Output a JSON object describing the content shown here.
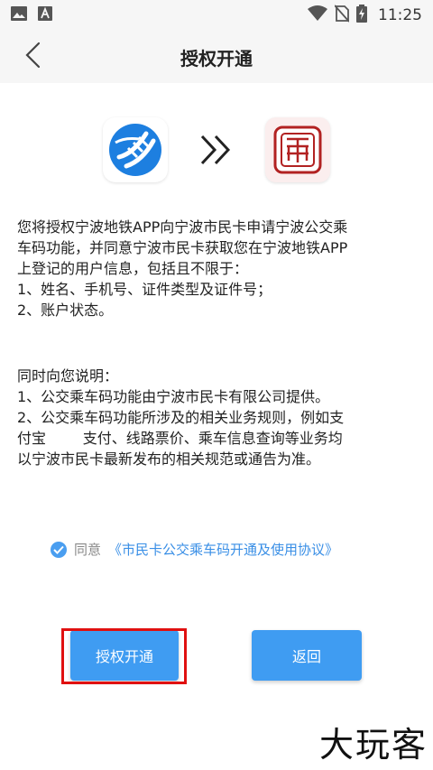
{
  "status_bar": {
    "time": "11:25",
    "icons": [
      "image-icon",
      "a-icon",
      "wifi-icon",
      "no-sim-icon",
      "battery-charging-icon"
    ]
  },
  "nav": {
    "title": "授权开通",
    "back_icon": "chevron-left-icon"
  },
  "logos": {
    "left": "ningbo-metro-logo",
    "middle": "double-chevron-right-icon",
    "right": "ningbo-citizen-card-logo"
  },
  "paragraph1": {
    "lines": [
      "您将授权宁波地铁APP向宁波市民卡申请宁波公交乘",
      "车码功能，并同意宁波市民卡获取您在宁波地铁APP",
      "上登记的用户信息，包括且不限于：",
      "1、姓名、手机号、证件类型及证件号；",
      "2、账户状态。"
    ]
  },
  "paragraph2": {
    "lines": [
      "同时向您说明：",
      "1、公交乘车码功能由宁波市民卡有限公司提供。",
      "2、公交乘车码功能所涉及的相关业务规则，例如支",
      "付宝        支付、线路票价、乘车信息查询等业务均",
      "以宁波市民卡最新发布的相关规范或通告为准。"
    ]
  },
  "agreement": {
    "checked": true,
    "prefix": "同意",
    "link": "《市民卡公交乘车码开通及使用协议》"
  },
  "buttons": {
    "authorize": "授权开通",
    "return": "返回"
  },
  "colors": {
    "accent": "#3f9cf2",
    "highlight": "#e01010"
  },
  "watermark": "大玩客"
}
